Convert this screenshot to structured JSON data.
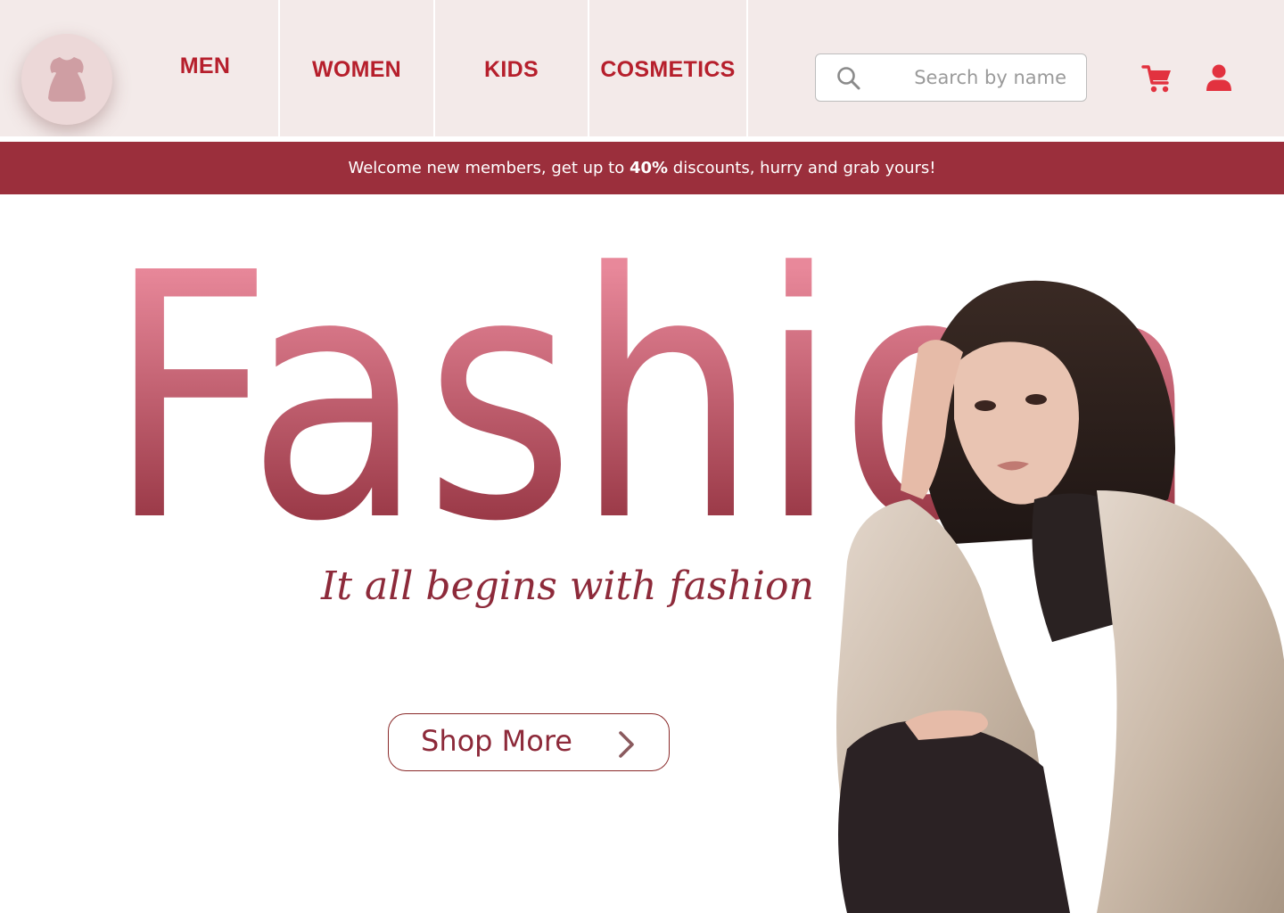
{
  "header": {
    "logo_icon": "dress-icon",
    "nav": [
      {
        "label": "MEN"
      },
      {
        "label": "WOMEN"
      },
      {
        "label": "KIDS"
      },
      {
        "label": "COSMETICS"
      }
    ],
    "search": {
      "placeholder": "Search by name",
      "value": "",
      "icon": "search-icon"
    },
    "cart_icon": "cart-icon",
    "user_icon": "user-icon"
  },
  "banner": {
    "text_before": "Welcome new members, get up to ",
    "highlight": "40%",
    "text_after": " discounts, hurry and grab yours!"
  },
  "hero": {
    "headline": "Fashion",
    "tagline": "It all begins with fashion",
    "cta_label": "Shop More",
    "cta_icon": "chevron-right-icon"
  },
  "colors": {
    "header_bg": "#f3eae9",
    "nav_text": "#b61f2c",
    "banner_bg": "#9b2f3c",
    "headline_top": "#e8889a",
    "headline_bottom": "#9b3a48",
    "accent": "#8d2a3a",
    "cart": "#e2323f"
  }
}
